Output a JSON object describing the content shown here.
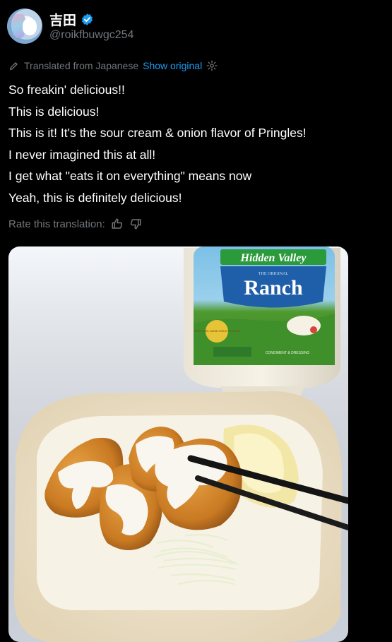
{
  "author": {
    "display_name": "吉田",
    "handle": "@roikfbuwgc254",
    "verified": true
  },
  "translation_bar": {
    "label": "Translated from Japanese",
    "show_original": "Show original",
    "icon": "translate-icon",
    "settings_icon": "gear-icon"
  },
  "tweet": {
    "lines": [
      "So freakin' delicious!!",
      "This is delicious!",
      "This is it! It's the sour cream & onion flavor of Pringles!",
      "I never imagined this at all!",
      "I get what \"eats it on everything\" means now",
      "Yeah, this is definitely delicious!"
    ]
  },
  "rate": {
    "label": "Rate this translation:",
    "up_icon": "thumbs-up-icon",
    "down_icon": "thumbs-down-icon"
  },
  "photo": {
    "bottle_brand": "Hidden Valley",
    "bottle_sub": "THE ORIGINAL",
    "bottle_product": "Ranch",
    "bottle_note": "NEW LOOK SAME GREAT FLAVOR",
    "bottle_bottom": "CONDIMENT & DRESSING"
  },
  "colors": {
    "background": "#000000",
    "text": "#ffffff",
    "muted": "#71767b",
    "link": "#1d9bf0",
    "verified": "#1d9bf0"
  }
}
